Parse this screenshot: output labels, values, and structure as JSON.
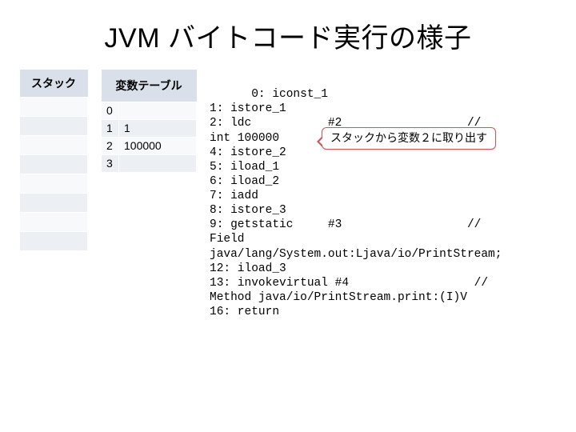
{
  "title": "JVM バイトコード実行の様子",
  "stack": {
    "header": "スタック",
    "rows": [
      "",
      "",
      "",
      "",
      "",
      "",
      "",
      ""
    ]
  },
  "varTable": {
    "header": "変数テーブル",
    "rows": [
      {
        "idx": "0",
        "val": ""
      },
      {
        "idx": "1",
        "val": "1"
      },
      {
        "idx": "2",
        "val": "100000"
      },
      {
        "idx": "3",
        "val": ""
      }
    ]
  },
  "callout": "スタックから変数２に取り出す",
  "code": "0: iconst_1\n1: istore_1\n2: ldc           #2                  //\nint 100000\n4: istore_2\n5: iload_1\n6: iload_2\n7: iadd\n8: istore_3\n9: getstatic     #3                  //\nField\njava/lang/System.out:Ljava/io/PrintStream;\n12: iload_3\n13: invokevirtual #4                  //\nMethod java/io/PrintStream.print:(I)V\n16: return"
}
